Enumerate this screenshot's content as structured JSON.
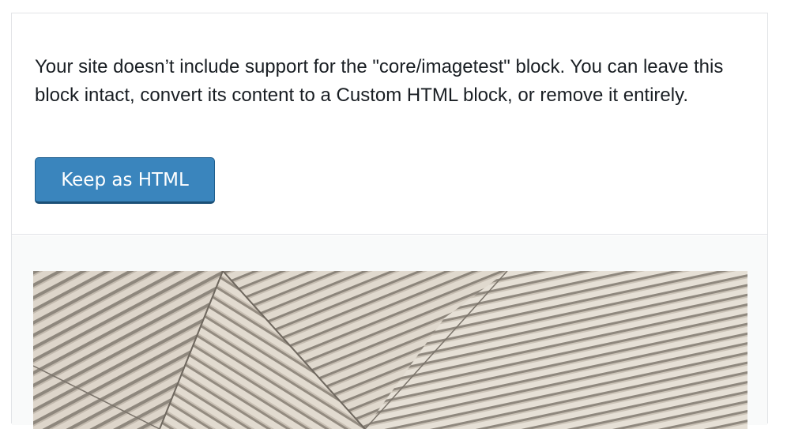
{
  "warning": {
    "message": "Your site doesn’t include support for the \"core/imagetest\" block. You can leave this block intact, convert its content to a Custom HTML block, or remove it entirely.",
    "keep_button_label": "Keep as HTML"
  },
  "preview": {
    "image_description": "wood-slat-pattern-image"
  },
  "colors": {
    "button": "#3a85bd",
    "border": "#e2e4e7",
    "preview_background": "#f9fafa",
    "text": "#191e23"
  }
}
